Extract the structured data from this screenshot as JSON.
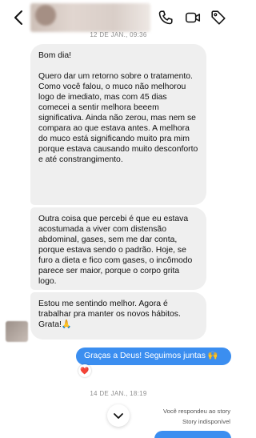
{
  "header": {
    "icons": [
      "back-chevron-icon",
      "phone-icon",
      "video-camera-icon",
      "tag-icon"
    ]
  },
  "conversation": {
    "date_top": "12 DE JAN., 09:36",
    "messages_in": [
      "Bom dia!\n\nQuero dar um retorno sobre o tratamento.\nComo você falou, o muco não melhorou logo de imediato, mas com 45 dias comecei a sentir melhora beeem significativa. Ainda não zerou, mas nem se compara ao que estava antes. A melhora do muco está significando muito pra mim porque estava causando muito desconforto e até constrangimento.",
      "Outra coisa que percebi é que eu estava acostumada a viver com distensão abdominal, gases, sem me dar conta, porque estava sendo o padrão. Hoje, se furo a dieta e fico com gases, o incômodo parece ser maior, porque o corpo grita logo.",
      "Estou me sentindo melhor. Agora é trabalhar pra manter os novos hábitos. Grata!🙏"
    ],
    "message_out": "Graças a Deus! Seguimos juntas 🙌",
    "reaction": "❤️",
    "date_bottom": "14 DE JAN., 18:19",
    "story_reply_note": "Você respondeu ao story",
    "story_unavailable": "Story indisponível"
  },
  "colors": {
    "incoming_bubble": "#efefef",
    "outgoing_bubble": "#3b8ef0",
    "meta_text": "#8e8e8e"
  }
}
